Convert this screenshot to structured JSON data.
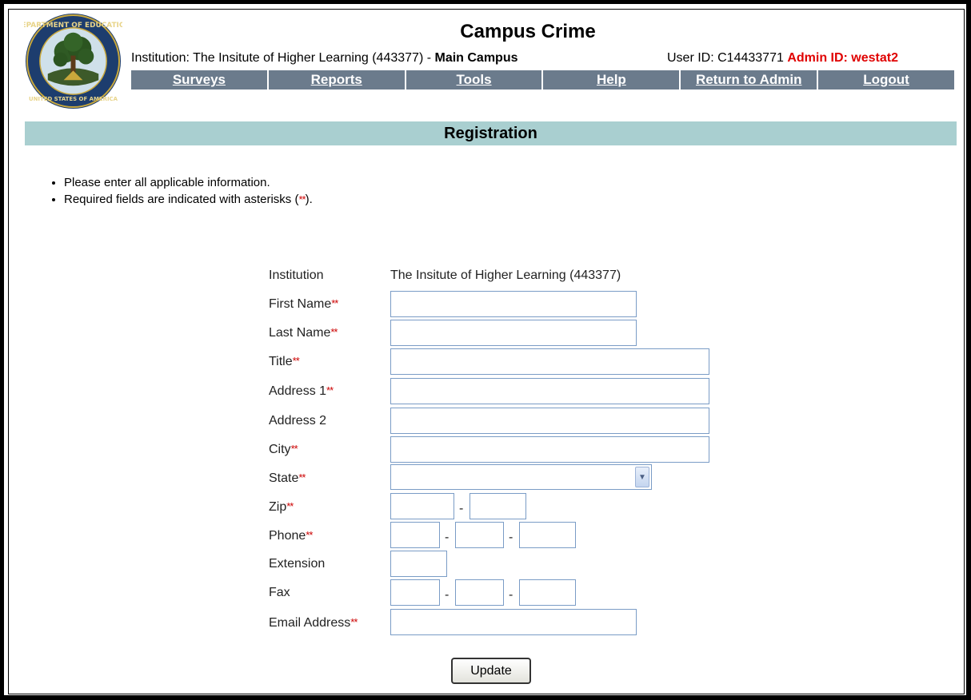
{
  "header": {
    "app_title": "Campus Crime",
    "institution_prefix": "Institution: The Insitute of Higher Learning (443377) - ",
    "campus": "Main Campus",
    "user_id_text": "User ID: C14433771 ",
    "admin_id_text": "Admin ID: westat2",
    "seal_text_top": "DEPARTMENT OF EDUCATION",
    "seal_text_bottom": "UNITED STATES OF AMERICA"
  },
  "nav": {
    "items": [
      {
        "label": "Surveys"
      },
      {
        "label": "Reports"
      },
      {
        "label": "Tools"
      },
      {
        "label": "Help"
      },
      {
        "label": "Return to Admin"
      },
      {
        "label": "Logout"
      }
    ]
  },
  "section_title": "Registration",
  "instructions": {
    "line1": "Please enter all applicable information.",
    "line2_prefix": "Required fields are indicated with asterisks (",
    "line2_suffix": ")."
  },
  "required_marker": "**",
  "form": {
    "institution_label": "Institution",
    "institution_value": "The Insitute of Higher Learning (443377)",
    "first_name_label": "First Name",
    "last_name_label": "Last Name",
    "title_label": "Title",
    "address1_label": "Address 1",
    "address2_label": "Address 2",
    "city_label": "City",
    "state_label": "State",
    "state_value": "",
    "zip_label": "Zip",
    "phone_label": "Phone",
    "extension_label": "Extension",
    "fax_label": "Fax",
    "email_label": "Email Address",
    "dash": "-",
    "update_label": "Update"
  },
  "colors": {
    "nav_bg": "#6b7b8c",
    "section_bg": "#a9cfd0",
    "required": "#cc0000",
    "admin_id": "#e00000"
  }
}
